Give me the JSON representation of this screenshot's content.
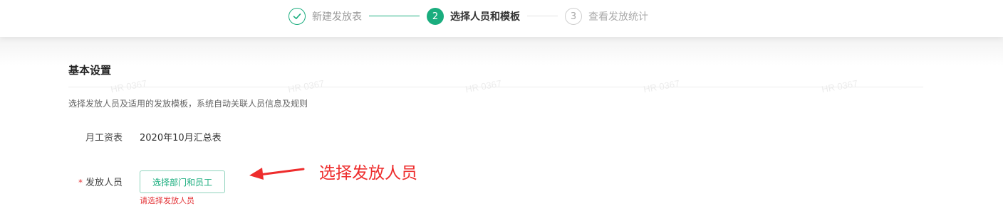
{
  "stepper": {
    "steps": [
      {
        "status": "done",
        "label": "新建发放表"
      },
      {
        "status": "current",
        "number": "2",
        "label": "选择人员和模板"
      },
      {
        "status": "pending",
        "number": "3",
        "label": "查看发放统计"
      }
    ],
    "colors": {
      "active": "#1aad7e",
      "pending": "#cfcfcf"
    }
  },
  "watermark": "HR 0367",
  "basic_settings": {
    "title": "基本设置",
    "description": "选择发放人员及适用的发放模板，系统自动关联人员信息及规则",
    "template_label": "月工资表",
    "template_value": "2020年10月汇总表",
    "people_required_mark": "*",
    "people_label": "发放人员",
    "select_button_label": "选择部门和员工",
    "people_error": "请选择发放人员"
  },
  "annotation": {
    "text": "选择发放人员",
    "color": "#ee2d2d"
  }
}
